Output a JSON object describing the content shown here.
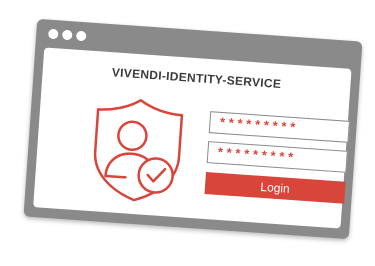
{
  "app": {
    "title": "VIVENDI-IDENTITY-SERVICE"
  },
  "window_controls": [
    "window-dot",
    "window-dot",
    "window-dot"
  ],
  "form": {
    "username_value": "*********",
    "password_value": "*********",
    "login_label": "Login"
  },
  "illustration": {
    "icon": "user-shield-check-icon"
  },
  "colors": {
    "frame": "#8a8a8a",
    "accent": "#d8453b",
    "background": "#ffffff",
    "title_text": "#3b3b3b"
  }
}
